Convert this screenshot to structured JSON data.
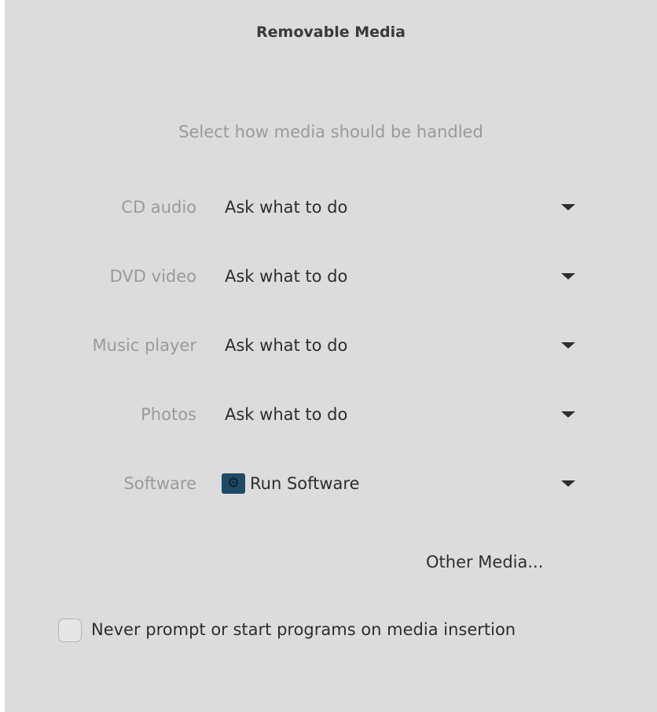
{
  "window": {
    "title": "Removable Media",
    "subtitle": "Select how media should be handled"
  },
  "handlers": [
    {
      "label": "CD audio",
      "value": "Ask what to do",
      "icon": null
    },
    {
      "label": "DVD video",
      "value": "Ask what to do",
      "icon": null
    },
    {
      "label": "Music player",
      "value": "Ask what to do",
      "icon": null
    },
    {
      "label": "Photos",
      "value": "Ask what to do",
      "icon": null
    },
    {
      "label": "Software",
      "value": "Run Software",
      "icon": "gear-icon"
    }
  ],
  "other_media_label": "Other Media...",
  "never_prompt": {
    "label": "Never prompt or start programs on media insertion",
    "checked": false
  },
  "colors": {
    "background": "#dcdcdc",
    "label_gray": "#9a9a9a",
    "text": "#2e2e2e",
    "app_icon": "#1e4a66"
  }
}
